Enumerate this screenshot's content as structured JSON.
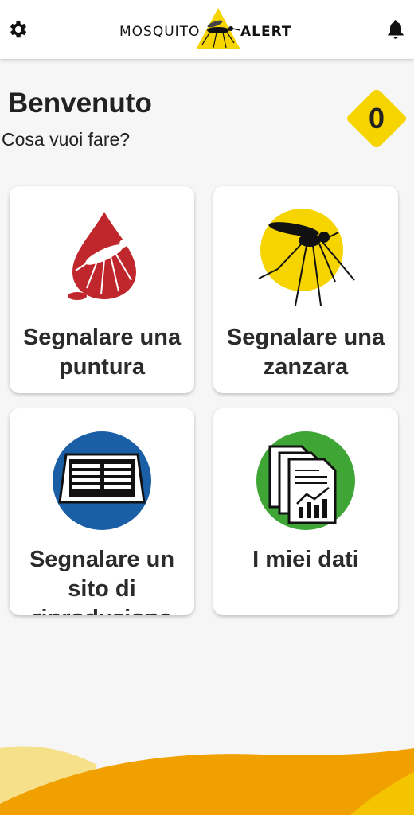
{
  "header": {
    "logo_left": "MOSQUITO",
    "logo_right": "ALERT",
    "settings_icon": "gear-icon",
    "notifications_icon": "bell-icon"
  },
  "welcome": {
    "title": "Benvenuto",
    "subtitle": "Cosa vuoi fare?",
    "score": "0"
  },
  "cards": [
    {
      "label": "Segnalare una puntura",
      "icon": "blood-drop-bite-icon"
    },
    {
      "label": "Segnalare una zanzara",
      "icon": "mosquito-icon"
    },
    {
      "label": "Segnalare un sito di riproduzione",
      "icon": "storm-drain-icon"
    },
    {
      "label": "I miei dati",
      "icon": "documents-chart-icon"
    }
  ],
  "colors": {
    "accent_yellow": "#f5c400",
    "bite_red": "#c0272d",
    "site_blue": "#1a5fa6",
    "data_green": "#3fa535",
    "wave_orange": "#f0a000"
  }
}
